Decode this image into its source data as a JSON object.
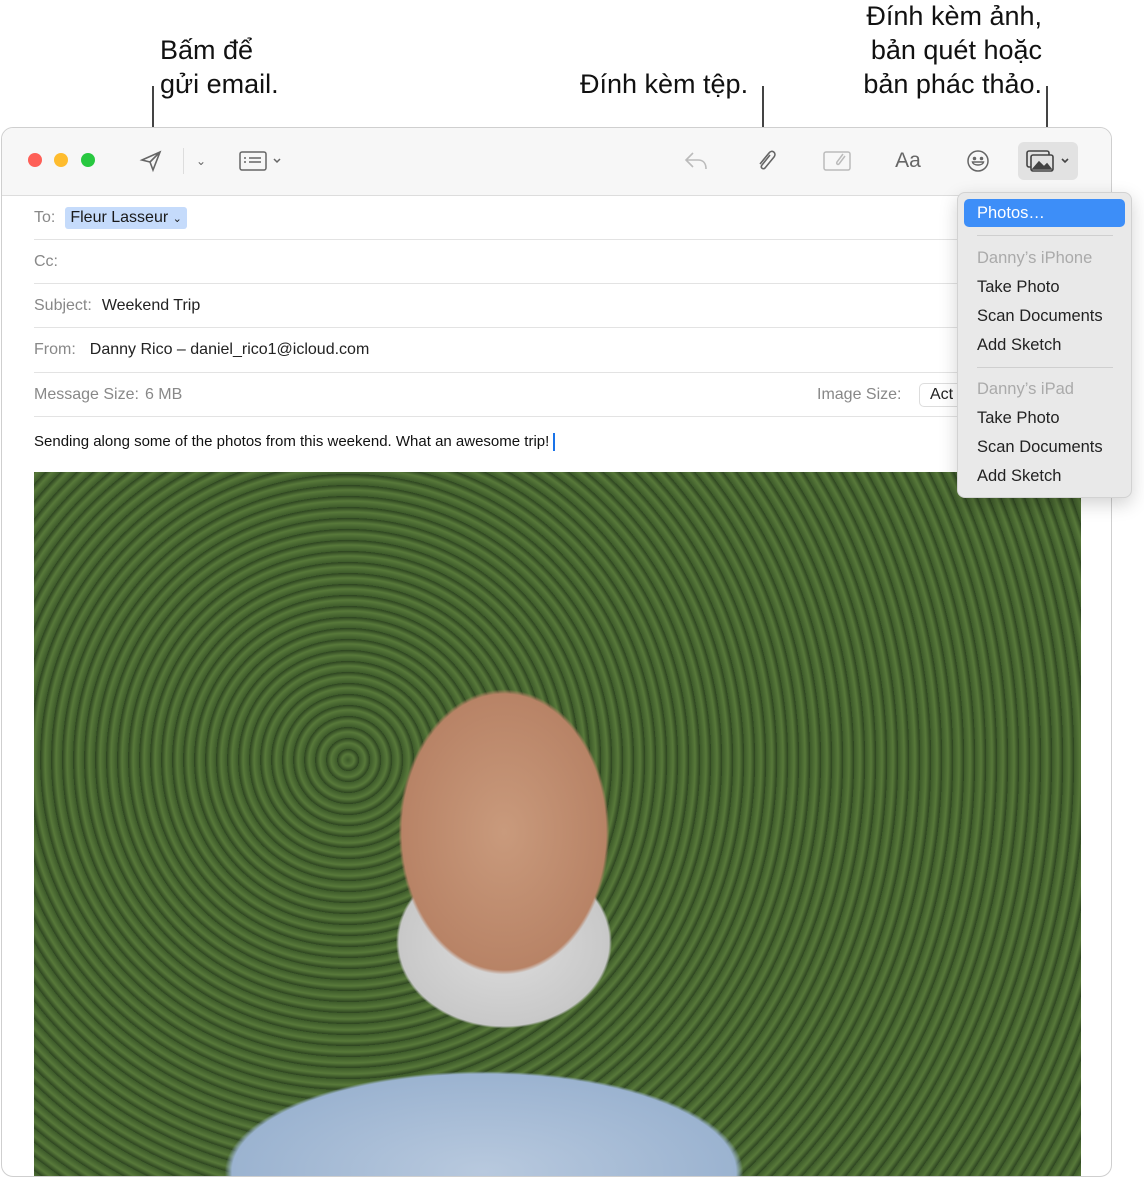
{
  "callouts": {
    "send": "Bấm để\ngửi email.",
    "attach": "Đính kèm tệp.",
    "photo": "Đính kèm ảnh,\nbản quét hoặc\nbản phác thảo."
  },
  "toolbar": {
    "icons": [
      "send-icon",
      "chevron-down-icon",
      "header-fields-icon",
      "reply-icon",
      "paperclip-icon",
      "attach-in-place-icon",
      "format-icon",
      "emoji-icon",
      "photo-browser-icon"
    ],
    "format_label": "Aa"
  },
  "header": {
    "to_label": "To:",
    "to_value": "Fleur Lasseur",
    "cc_label": "Cc:",
    "subject_label": "Subject:",
    "subject_value": "Weekend Trip",
    "from_label": "From:",
    "from_value": "Danny Rico – daniel_rico1@icloud.com",
    "size_label": "Message Size:",
    "size_value": "6 MB",
    "image_size_label": "Image Size:",
    "image_size_value": "Act"
  },
  "body": {
    "text": "Sending along some of the photos from this weekend. What an awesome trip!"
  },
  "menu": {
    "items": [
      {
        "label": "Photos…",
        "selected": true
      },
      {
        "label": "Danny’s iPhone",
        "disabled": true
      },
      {
        "label": "Take Photo"
      },
      {
        "label": "Scan Documents"
      },
      {
        "label": "Add Sketch"
      },
      {
        "label": "Danny’s iPad",
        "disabled": true
      },
      {
        "label": "Take Photo"
      },
      {
        "label": "Scan Documents"
      },
      {
        "label": "Add Sketch"
      }
    ]
  },
  "colors": {
    "accent": "#3d8ef8",
    "chip": "#c5dbfb",
    "close": "#fe5f57",
    "minimize": "#febc2e",
    "zoom": "#28c840"
  }
}
